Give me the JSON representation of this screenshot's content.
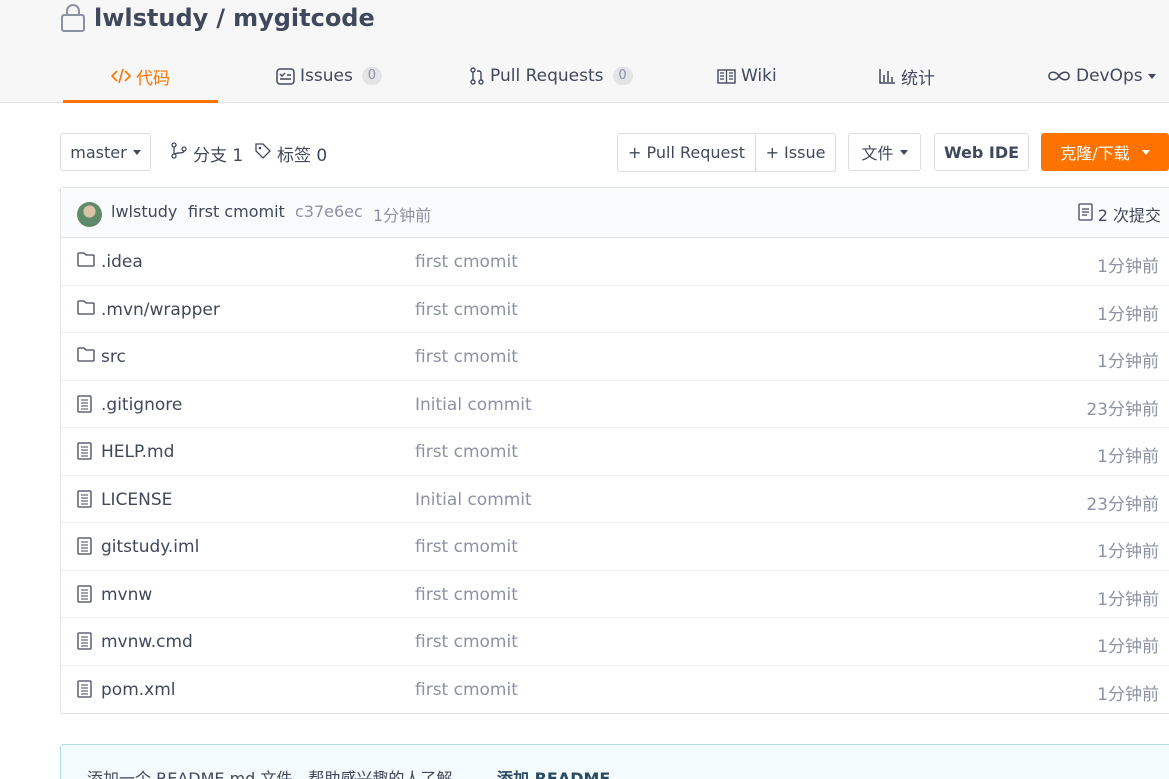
{
  "repo": {
    "owner": "lwlstudy",
    "separator": "/",
    "name": "mygitcode"
  },
  "tabs": [
    {
      "label": "代码",
      "icon": "code-icon",
      "active": true
    },
    {
      "label": "Issues",
      "icon": "issues-icon",
      "badge": "0"
    },
    {
      "label": "Pull Requests",
      "icon": "pull-request-icon",
      "badge": "0"
    },
    {
      "label": "Wiki",
      "icon": "wiki-icon"
    },
    {
      "label": "统计",
      "icon": "chart-icon"
    },
    {
      "label": "DevOps",
      "icon": "infinity-icon",
      "has_dropdown": true
    }
  ],
  "toolbar": {
    "branch": "master",
    "branches_label": "分支 1",
    "tags_label": "标签 0",
    "pull_request_button": "+ Pull Request",
    "issue_button": "+ Issue",
    "file_button": "文件",
    "web_ide_button": "Web IDE",
    "clone_button": "克隆/下载"
  },
  "last_commit": {
    "author": "lwlstudy",
    "message": "first cmomit",
    "sha": "c37e6ec",
    "time": "1分钟前",
    "commit_count": "2 次提交"
  },
  "files": [
    {
      "name": ".idea",
      "type": "folder",
      "commit": "first cmomit",
      "time": "1分钟前"
    },
    {
      "name": ".mvn/wrapper",
      "type": "folder",
      "commit": "first cmomit",
      "time": "1分钟前"
    },
    {
      "name": "src",
      "type": "folder",
      "commit": "first cmomit",
      "time": "1分钟前"
    },
    {
      "name": ".gitignore",
      "type": "file",
      "commit": "Initial commit",
      "time": "23分钟前"
    },
    {
      "name": "HELP.md",
      "type": "file",
      "commit": "first cmomit",
      "time": "1分钟前"
    },
    {
      "name": "LICENSE",
      "type": "file",
      "commit": "Initial commit",
      "time": "23分钟前"
    },
    {
      "name": "gitstudy.iml",
      "type": "file",
      "commit": "first cmomit",
      "time": "1分钟前"
    },
    {
      "name": "mvnw",
      "type": "file",
      "commit": "first cmomit",
      "time": "1分钟前"
    },
    {
      "name": "mvnw.cmd",
      "type": "file",
      "commit": "first cmomit",
      "time": "1分钟前"
    },
    {
      "name": "pom.xml",
      "type": "file",
      "commit": "first cmomit",
      "time": "1分钟前"
    }
  ],
  "readme_hint": {
    "text": "添加一个 README.md 文件，帮助感兴趣的人了解",
    "link": "添加 README"
  },
  "colors": {
    "accent": "#fe7300",
    "text": "#40485b",
    "muted": "#8c92a4"
  }
}
